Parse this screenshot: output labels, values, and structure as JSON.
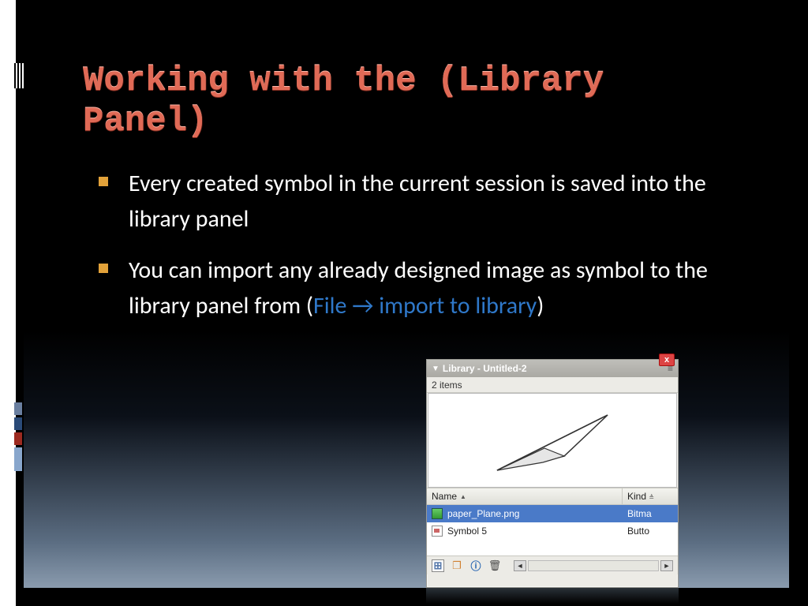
{
  "title": "Working with the (Library Panel)",
  "bullets": {
    "b1": "Every created symbol in the current session is saved into the library panel",
    "b2_pre": "You can import any already designed image as symbol to the library panel from (",
    "b2_link_file": "File",
    "b2_arrow": "→",
    "b2_link_import": "import to library",
    "b2_post": ")"
  },
  "panel": {
    "title": "Library - Untitled-2",
    "close": "x",
    "item_count": "2 items",
    "col_name": "Name",
    "col_kind": "Kind",
    "rows": [
      {
        "name": "paper_Plane.png",
        "kind": "Bitma"
      },
      {
        "name": "Symbol 5",
        "kind": "Butto"
      }
    ],
    "footer": {
      "new": "⊞",
      "folder": "❐",
      "info": "ⓘ",
      "trash": "🗑",
      "left": "◄",
      "right": "►"
    }
  }
}
